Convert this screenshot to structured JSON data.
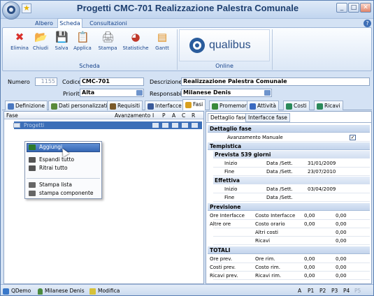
{
  "window": {
    "title": "Progetti CMC-701 Realizzazione Palestra Comunale",
    "controls": {
      "minimize": "_",
      "maximize": "□",
      "close": "✕"
    },
    "help": "?"
  },
  "ribbon_tabs": [
    "Albero",
    "Scheda",
    "Consultazioni"
  ],
  "ribbon": {
    "buttons": [
      {
        "label": "Elimina",
        "icon": "delete-icon",
        "glyph": "✖",
        "color": "#d9302b"
      },
      {
        "label": "Chiudi",
        "icon": "folder-icon",
        "glyph": "📂",
        "color": "#e0a918"
      },
      {
        "label": "Salva",
        "icon": "save-icon",
        "glyph": "💾",
        "color": "#4a6fbf"
      },
      {
        "label": "Applica",
        "icon": "apply-icon",
        "glyph": "📋",
        "color": "#3f7cc7"
      },
      {
        "label": "Stampa",
        "icon": "print-icon",
        "glyph": "🖨",
        "color": "#7a7a7a"
      },
      {
        "label": "Statistiche",
        "icon": "statistics-icon",
        "glyph": "◕",
        "color": "#c0392b"
      },
      {
        "label": "Gantt",
        "icon": "gantt-icon",
        "glyph": "▤",
        "color": "#e08a14"
      }
    ],
    "group_scheda": "Scheda",
    "group_online": "Online",
    "qualibus": "qualibus"
  },
  "form": {
    "numero_label": "Numero",
    "numero_value": "1155",
    "codice_label": "Codice",
    "codice_value": "CMC-701",
    "descrizione_label": "Descrizione",
    "descrizione_value": "Realizzazione Palestra Comunale",
    "priorita_label": "Priorita",
    "priorita_value": "Alta",
    "responsabile_label": "Responsabile",
    "responsabile_value": "Milanese Denis"
  },
  "main_tabs": [
    {
      "label": "Definizione",
      "color": "#4a78c0"
    },
    {
      "label": "Dati personalizzati",
      "color": "#5a8a3a"
    },
    {
      "label": "Requisiti",
      "color": "#7a5a2a"
    },
    {
      "label": "Interfacce",
      "color": "#3a5a9a"
    },
    {
      "label": "Fasi",
      "color": "#d8a020"
    },
    {
      "label": "Promemoria",
      "color": "#3a8a3a"
    },
    {
      "label": "Attività",
      "color": "#3a6ac0"
    },
    {
      "label": "Costi",
      "color": "#2a8a5a"
    },
    {
      "label": "Ricavi",
      "color": "#2a8a5a"
    }
  ],
  "left_grid": {
    "headers": {
      "fase": "Fase",
      "avanzamento": "Avanzamento",
      "i": "I",
      "p": "P",
      "a": "A",
      "c": "C",
      "r": "R"
    },
    "row": "Progetti"
  },
  "context_menu": [
    {
      "label": "Aggiungi",
      "icon": "add-icon",
      "color": "#2c7a2c"
    },
    {
      "label": "Espandi tutto",
      "icon": "expand-icon",
      "color": "#555"
    },
    {
      "label": "Ritrai tutto",
      "icon": "collapse-icon",
      "color": "#555"
    },
    {
      "label": "Stampa lista",
      "icon": "print-list-icon",
      "color": "#666"
    },
    {
      "label": "stampa componente",
      "icon": "print-component-icon",
      "color": "#666"
    }
  ],
  "right_tabs": [
    "Dettaglio fase",
    "Interfacce fase"
  ],
  "detail": {
    "dettaglio": "Dettaglio fase",
    "avanzamento": "Avanzamento",
    "manuale": "Manuale",
    "tempistica": "Tempistica",
    "prevista": "Prevista 539 giorni",
    "effettiva": "Effettiva",
    "inizio": "Inizio",
    "fine": "Fine",
    "datasett": "Data /Sett.",
    "prev_inizio": "31/01/2009",
    "prev_fine": "23/07/2010",
    "eff_inizio": "03/04/2009",
    "eff_fine": "",
    "previsione": "Previsione",
    "ore_interfacce": "Ore Interfacce",
    "altre_ore": "Altre ore",
    "costo_interfacce": "Costo Interfacce",
    "costo_orario": "Costo orario",
    "altri_costi": "Altri costi",
    "ricavi": "Ricavi",
    "v1": "0,00",
    "v2": "0,00",
    "v3": "0,00",
    "v4": "0,00",
    "v5": "0,00",
    "v6": "0,00",
    "totali": "TOTALI",
    "ore_prev": "Ore prev.",
    "costi_prev": "Costi prev.",
    "ricavi_prev": "Ricavi prev.",
    "ore_rim": "Ore rim.",
    "costo_rim": "Costo rim.",
    "ricavi_rim": "Ricavi rim.",
    "t1": "0,00",
    "t2": "0,00",
    "t3": "0,00",
    "t4": "0,00",
    "t5": "0,00",
    "t6": "0,00"
  },
  "status": {
    "app": "QDemo",
    "user": "Milanese Denis",
    "mode": "Modifica",
    "a": "A",
    "p1": "P1",
    "p2": "P2",
    "p3": "P3",
    "p4": "P4",
    "p5": "P5"
  }
}
